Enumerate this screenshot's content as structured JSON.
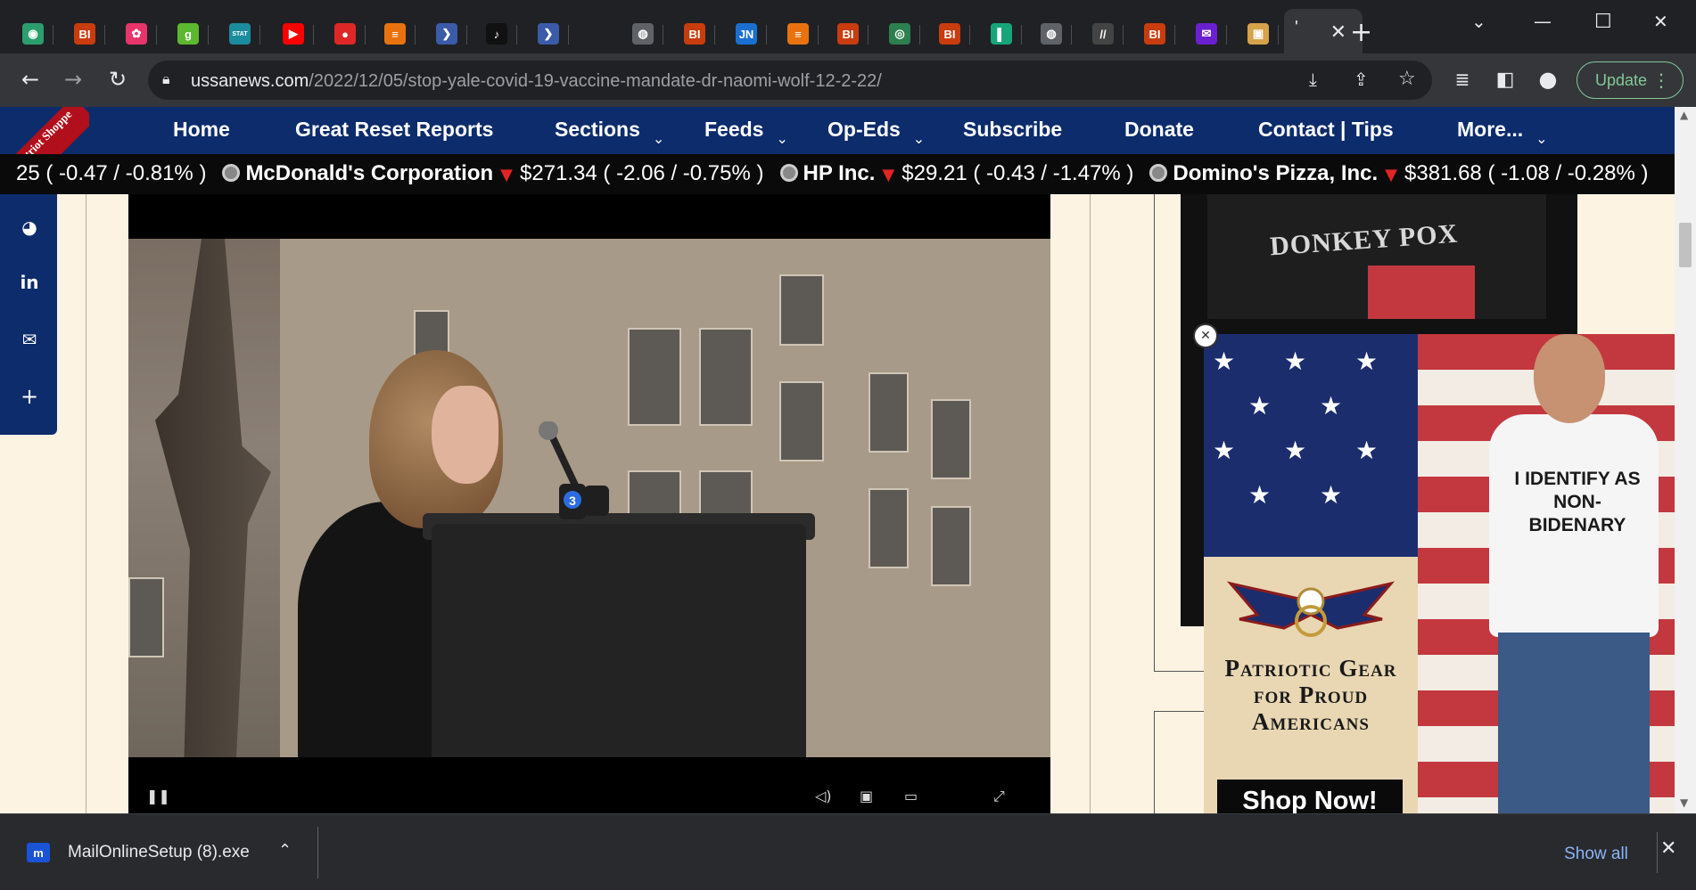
{
  "browser": {
    "tabs": [
      {
        "icon": "globe-icon",
        "color": "#2b9e6e",
        "glyph": "◉"
      },
      {
        "icon": "bi-icon",
        "color": "#c83c0e",
        "glyph": "BI"
      },
      {
        "icon": "pinwheel-icon",
        "color": "#e6356b",
        "glyph": "✿"
      },
      {
        "icon": "g-icon",
        "color": "#5cb82e",
        "glyph": "g"
      },
      {
        "icon": "stat-icon",
        "color": "#1b8c9e",
        "glyph": "STAT"
      },
      {
        "icon": "youtube-icon",
        "color": "#ff0000",
        "glyph": "▶"
      },
      {
        "icon": "mic-icon",
        "color": "#e02727",
        "glyph": "●"
      },
      {
        "icon": "bookmark-icon",
        "color": "#e8730e",
        "glyph": "≡"
      },
      {
        "icon": "arrow-icon",
        "color": "#3a5ba8",
        "glyph": "❯"
      },
      {
        "icon": "tiktok-icon",
        "color": "#111111",
        "glyph": "♪"
      },
      {
        "icon": "arrow-icon",
        "color": "#3a5ba8",
        "glyph": "❯"
      },
      {
        "icon": "globe-icon",
        "color": "#5f6368",
        "glyph": "◍"
      },
      {
        "icon": "bi-icon",
        "color": "#c83c0e",
        "glyph": "BI"
      },
      {
        "icon": "jn-icon",
        "color": "#1a6fd1",
        "glyph": "JN"
      },
      {
        "icon": "bookmark-icon",
        "color": "#e8730e",
        "glyph": "≡"
      },
      {
        "icon": "bi-icon",
        "color": "#c83c0e",
        "glyph": "BI"
      },
      {
        "icon": "seal-icon",
        "color": "#2d7f4f",
        "glyph": "◎"
      },
      {
        "icon": "bi-icon",
        "color": "#c83c0e",
        "glyph": "BI"
      },
      {
        "icon": "flag-icon",
        "color": "#16a57a",
        "glyph": "▌"
      },
      {
        "icon": "globe-icon",
        "color": "#5f6368",
        "glyph": "◍"
      },
      {
        "icon": "gt-icon",
        "color": "#444444",
        "glyph": "//"
      },
      {
        "icon": "bi-icon",
        "color": "#c83c0e",
        "glyph": "BI"
      },
      {
        "icon": "mail-icon",
        "color": "#6a1fd1",
        "glyph": "✉"
      },
      {
        "icon": "photo-icon",
        "color": "#d6a24a",
        "glyph": "▣"
      }
    ],
    "active_tab_label": "'",
    "new_tab": "+",
    "url_host": "ussanews.com",
    "url_path": "/2022/12/05/stop-yale-covid-19-vaccine-mandate-dr-naomi-wolf-12-2-22/",
    "update_label": "Update"
  },
  "site": {
    "ribbon": "Ye Olde Patriot Shoppe",
    "nav": [
      {
        "label": "Home",
        "dropdown": false
      },
      {
        "label": "Great Reset Reports",
        "dropdown": false
      },
      {
        "label": "Sections",
        "dropdown": true
      },
      {
        "label": "Feeds",
        "dropdown": true
      },
      {
        "label": "Op-Eds",
        "dropdown": true
      },
      {
        "label": "Subscribe",
        "dropdown": false
      },
      {
        "label": "Donate",
        "dropdown": false
      },
      {
        "label": "Contact | Tips",
        "dropdown": false
      },
      {
        "label": "More...",
        "dropdown": true
      }
    ],
    "ticker": [
      {
        "name": "",
        "price": "",
        "change": "25 ( -0.47 / -0.81% )"
      },
      {
        "name": "McDonald's Corporation",
        "price": "$271.34",
        "change": "( -2.06 / -0.75% )"
      },
      {
        "name": "HP Inc.",
        "price": "$29.21",
        "change": "( -0.43 / -1.47% )"
      },
      {
        "name": "Domino's Pizza, Inc.",
        "price": "$381.68",
        "change": "( -1.08 / -0.28% )"
      }
    ],
    "share_icons": [
      "reddit-icon",
      "linkedin-icon",
      "email-icon",
      "plus-icon"
    ],
    "tshirt_text": "DONKEY POX",
    "ad": {
      "headline": "Patriotic Gear for Proud Americans",
      "cta": "Shop Now!",
      "shirt_text": "I IDENTIFY AS NON-BIDENARY",
      "close": "✕"
    },
    "video": {
      "mic_logo": "3"
    }
  },
  "downloads": {
    "file_name": "MailOnlineSetup (8).exe",
    "show_all": "Show all"
  }
}
